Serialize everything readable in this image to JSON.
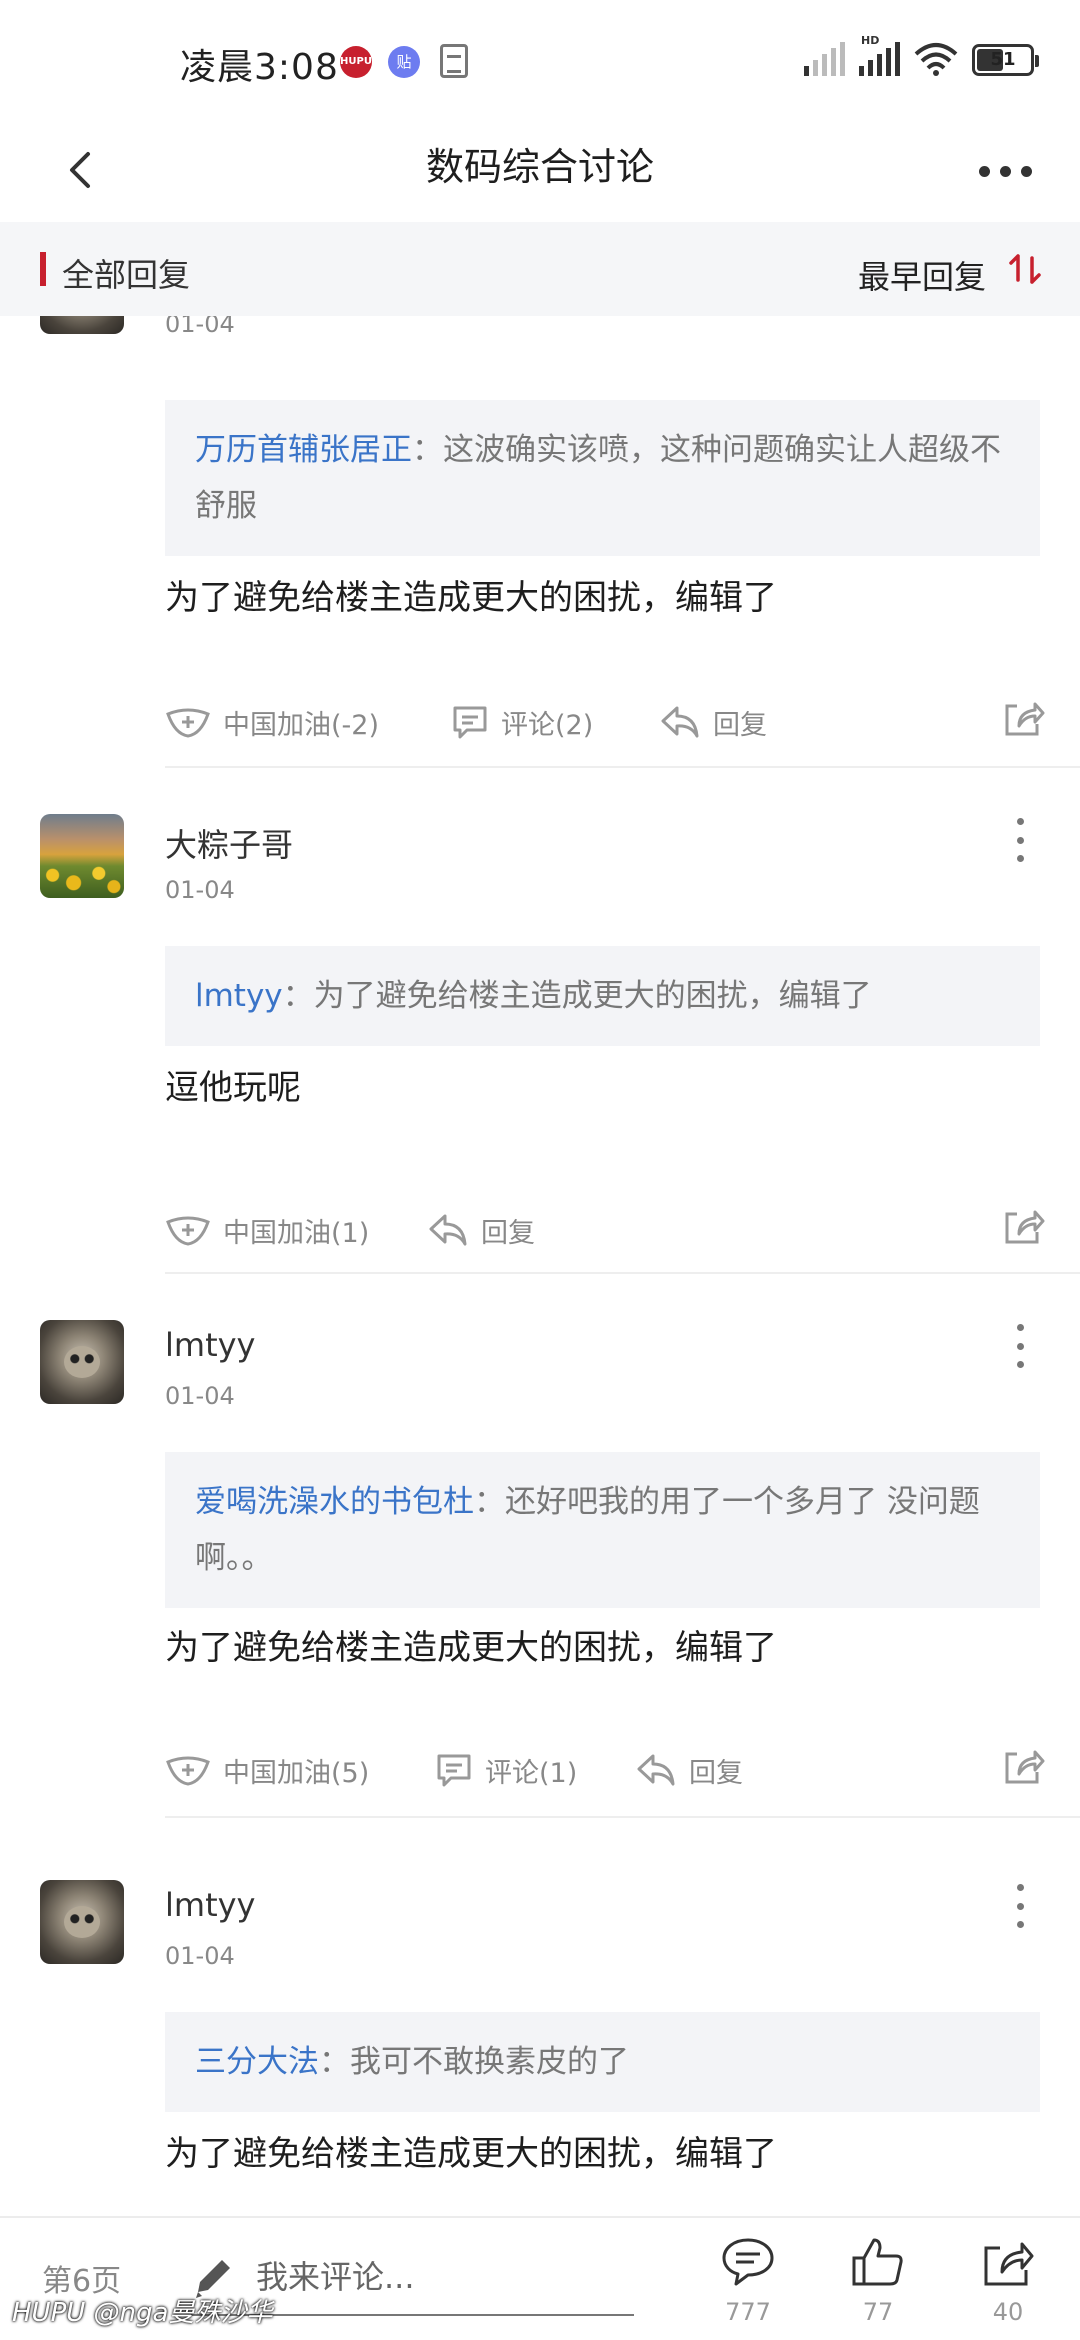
{
  "status_bar": {
    "time": "凌晨3:08",
    "app_icons": [
      "HUPU",
      "贴"
    ],
    "network": "HD",
    "battery": "51"
  },
  "nav": {
    "title": "数码综合讨论"
  },
  "filter": {
    "all_replies": "全部回复",
    "sort_label": "最早回复"
  },
  "posts": [
    {
      "username": "",
      "date": "01-04",
      "quote_user": "万历首辅张居正",
      "quote_text": "：这波确实该喷，这种问题确实让人超级不舒服",
      "content": "为了避免给楼主造成更大的困扰，编辑了",
      "cheer": "中国加油(-2)",
      "comment": "评论(2)",
      "reply": "回复"
    },
    {
      "username": "大粽子哥",
      "date": "01-04",
      "quote_user": "lmtyy",
      "quote_text": "：为了避免给楼主造成更大的困扰，编辑了",
      "content": "逗他玩呢",
      "cheer": "中国加油(1)",
      "reply": "回复"
    },
    {
      "username": "lmtyy",
      "date": "01-04",
      "quote_user": "爱喝洗澡水的书包杜",
      "quote_text": "：还好吧我的用了一个多月了 没问题啊。。",
      "content": "为了避免给楼主造成更大的困扰，编辑了",
      "cheer": "中国加油(5)",
      "comment": "评论(1)",
      "reply": "回复"
    },
    {
      "username": "lmtyy",
      "date": "01-04",
      "quote_user": "三分大法",
      "quote_text": "：我可不敢换素皮的了",
      "content": "为了避免给楼主造成更大的困扰，编辑了"
    }
  ],
  "bottom": {
    "page": "第6页",
    "input_placeholder": "我来评论...",
    "comments_count": "777",
    "likes_count": "77",
    "shares_count": "40"
  },
  "watermark": "HUPU @nga曼殊沙华",
  "colors": {
    "accent_red": "#c7202e",
    "quote_name_blue": "#3a74c8",
    "quote_bg": "#f3f4f7"
  }
}
